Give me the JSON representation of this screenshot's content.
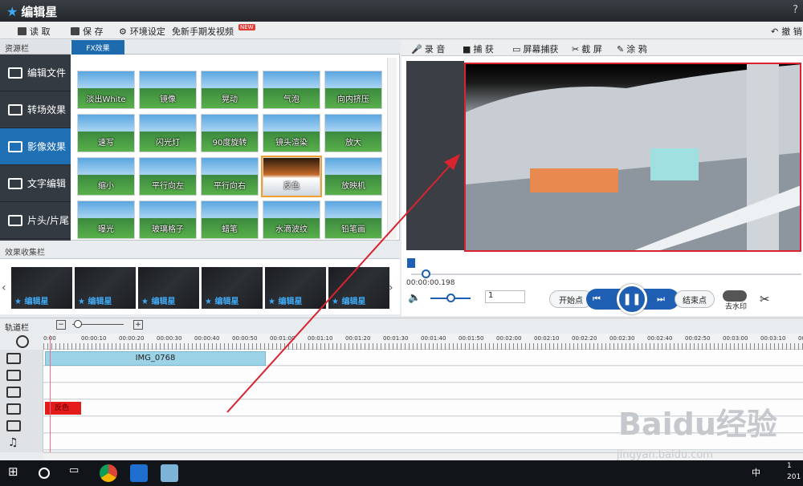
{
  "app": {
    "title": "编辑星",
    "help": "?"
  },
  "toolbar": {
    "read": "读 取",
    "save": "保 存",
    "env": "环境设定",
    "free_video": "免新手期发视频",
    "new_badge": "NEW",
    "back": "撤 销"
  },
  "left_panel": {
    "header": "资源栏",
    "tab": "FX效果",
    "sidebar": [
      "编辑文件",
      "转场效果",
      "影像效果",
      "文字编辑",
      "片头/片尾"
    ],
    "effects": [
      "淡出White",
      "镜像",
      "晃动",
      "气泡",
      "向内挤压",
      "速写",
      "闪光灯",
      "90度旋转",
      "镜头渲染",
      "放大",
      "缩小",
      "平行向左",
      "平行向右",
      "反色",
      "放映机",
      "曝光",
      "玻璃格子",
      "蜡笔",
      "水滴波纹",
      "铅笔画"
    ],
    "selected_effect": "反色"
  },
  "favorites": {
    "header": "效果收集栏",
    "items": [
      "编辑星",
      "编辑星",
      "编辑星",
      "编辑星",
      "编辑星",
      "编辑星"
    ]
  },
  "right_toolbar": {
    "record": "录 音",
    "capture": "捕 获",
    "screen_capture": "屏幕捕获",
    "screenshot": "截 屏",
    "doodle": "涂 鸦"
  },
  "player": {
    "time": "00:00:00.198",
    "frame_value": "1",
    "start_point": "开始点",
    "end_point": "结束点",
    "remove_watermark": "去水印"
  },
  "timeline": {
    "header": "轨道栏",
    "ticks": [
      "0:00",
      "00:00:10",
      "00:00:20",
      "00:00:30",
      "00:00:40",
      "00:00:50",
      "00:01:00",
      "00:01:10",
      "00:01:20",
      "00:01:30",
      "00:01:40",
      "00:01:50",
      "00:02:00",
      "00:02:10",
      "00:02:20",
      "00:02:30",
      "00:02:40",
      "00:02:50",
      "00:03:00",
      "00:03:10",
      "00:03:2"
    ],
    "clip_name": "IMG_0768",
    "fx_clip": "反色"
  },
  "taskbar": {
    "time": "1",
    "date": "201",
    "ime": "中"
  },
  "watermark": {
    "main": "Baidu经验",
    "sub": "jingyan.baidu.com"
  }
}
